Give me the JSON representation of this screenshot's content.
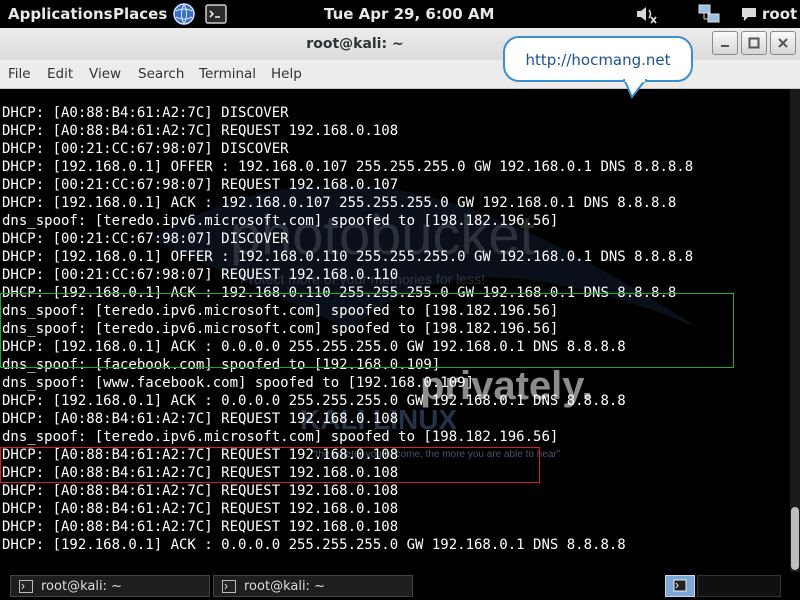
{
  "top_panel": {
    "applications": "Applications",
    "places": "Places",
    "clock": "Tue Apr 29,  6:00 AM",
    "user": "root",
    "icons": [
      "globe-icon",
      "terminal-icon",
      "volume-muted-icon",
      "network-icon",
      "chat-icon"
    ]
  },
  "window": {
    "title": "root@kali: ~",
    "buttons": [
      "minimize",
      "maximize",
      "close"
    ]
  },
  "menubar": {
    "file": "File",
    "edit": "Edit",
    "view": "View",
    "search": "Search",
    "terminal": "Terminal",
    "help": "Help"
  },
  "callout": {
    "text": "http://hocmang.net"
  },
  "terminal": {
    "lines": [
      "DHCP: [A0:88:B4:61:A2:7C] DISCOVER",
      "DHCP: [A0:88:B4:61:A2:7C] REQUEST 192.168.0.108",
      "DHCP: [00:21:CC:67:98:07] DISCOVER",
      "DHCP: [192.168.0.1] OFFER : 192.168.0.107 255.255.255.0 GW 192.168.0.1 DNS 8.8.8.8",
      "DHCP: [00:21:CC:67:98:07] REQUEST 192.168.0.107",
      "DHCP: [192.168.0.1] ACK : 192.168.0.107 255.255.255.0 GW 192.168.0.1 DNS 8.8.8.8",
      "dns_spoof: [teredo.ipv6.microsoft.com] spoofed to [198.182.196.56]",
      "DHCP: [00:21:CC:67:98:07] DISCOVER",
      "DHCP: [192.168.0.1] OFFER : 192.168.0.110 255.255.255.0 GW 192.168.0.1 DNS 8.8.8.8",
      "DHCP: [00:21:CC:67:98:07] REQUEST 192.168.0.110",
      "DHCP: [192.168.0.1] ACK : 192.168.0.110 255.255.255.0 GW 192.168.0.1 DNS 8.8.8.8",
      "dns_spoof: [teredo.ipv6.microsoft.com] spoofed to [198.182.196.56]",
      "dns_spoof: [teredo.ipv6.microsoft.com] spoofed to [198.182.196.56]",
      "DHCP: [192.168.0.1] ACK : 0.0.0.0 255.255.255.0 GW 192.168.0.1 DNS 8.8.8.8",
      "dns_spoof: [facebook.com] spoofed to [192.168.0.109]",
      "dns_spoof: [www.facebook.com] spoofed to [192.168.0.109]",
      "DHCP: [192.168.0.1] ACK : 0.0.0.0 255.255.255.0 GW 192.168.0.1 DNS 8.8.8.8",
      "DHCP: [A0:88:B4:61:A2:7C] REQUEST 192.168.0.108",
      "dns_spoof: [teredo.ipv6.microsoft.com] spoofed to [198.182.196.56]",
      "DHCP: [A0:88:B4:61:A2:7C] REQUEST 192.168.0.108",
      "DHCP: [A0:88:B4:61:A2:7C] REQUEST 192.168.0.108",
      "DHCP: [A0:88:B4:61:A2:7C] REQUEST 192.168.0.108",
      "DHCP: [A0:88:B4:61:A2:7C] REQUEST 192.168.0.108",
      "DHCP: [A0:88:B4:61:A2:7C] REQUEST 192.168.0.108",
      "DHCP: [192.168.0.1] ACK : 0.0.0.0 255.255.255.0 GW 192.168.0.1 DNS 8.8.8.8"
    ],
    "highlight_colors": {
      "green": "#1faa2a",
      "red": "#d02020"
    },
    "watermark": {
      "photobucket": "photobucket",
      "protect": "Protect more of your memories for less!",
      "privately": "privately.",
      "kali": "KALI LINUX",
      "hear": "\"the quieter you become, the more you are able to hear\""
    }
  },
  "taskbar": {
    "tasks": [
      {
        "label": "root@kali: ~"
      },
      {
        "label": "root@kali: ~"
      }
    ]
  }
}
